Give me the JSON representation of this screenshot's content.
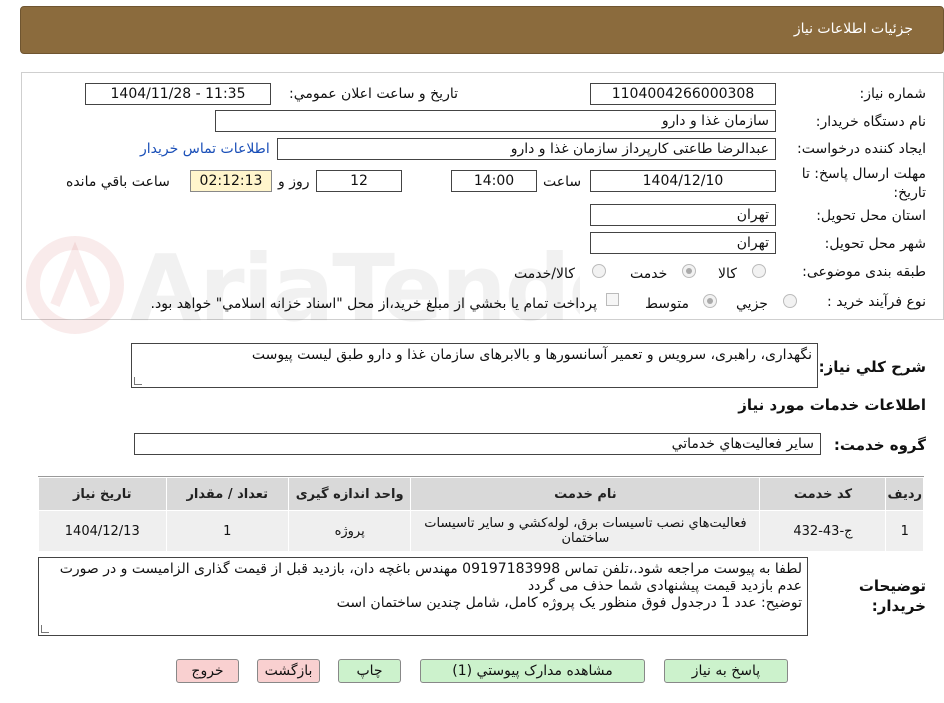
{
  "header": {
    "title": "جزئيات اطلاعات نياز"
  },
  "fields": {
    "need_number_label": "شماره نياز:",
    "need_number": "1104004266000308",
    "announce_label": "تاريخ و ساعت اعلان عمومي:",
    "announce_value": "1404/11/28 - 11:35",
    "buyer_org_label": "نام دستگاه خريدار:",
    "buyer_org": "سازمان غذا و دارو",
    "creator_label": "ايجاد کننده درخواست:",
    "creator": "عبدالرضا طاعتی کارپرداز سازمان غذا و دارو",
    "contact_link": "اطلاعات تماس خريدار",
    "deadline_label": "مهلت ارسال پاسخ: تا تاريخ:",
    "deadline_date": "1404/12/10",
    "time_label": "ساعت",
    "deadline_time": "14:00",
    "days_value": "12",
    "days_label": "روز و",
    "remaining_time": "02:12:13",
    "remaining_label": "ساعت باقي مانده",
    "province_label": "استان محل تحويل:",
    "province": "تهران",
    "city_label": "شهر محل تحويل:",
    "city": "تهران",
    "category_label": "طبقه بندی موضوعی:",
    "category_options": [
      "کالا",
      "خدمت",
      "کالا/خدمت"
    ],
    "process_label": "نوع فرآيند خريد :",
    "process_options": [
      "جزيي",
      "متوسط"
    ],
    "payment_note": "پرداخت تمام يا بخشي از مبلغ خريد،از محل \"اسناد خزانه اسلامي\" خواهد بود."
  },
  "description": {
    "label": "شرح کلي نياز:",
    "text": "نگهداری، راهبری، سرویس و تعمیر آسانسورها و بالابرهای سازمان غذا و دارو طبق لیست پیوست"
  },
  "services": {
    "section_title": "اطلاعات خدمات مورد نياز",
    "group_label": "گروه خدمت:",
    "group_value": "ساير فعاليت‌هاي خدماتي",
    "columns": [
      "رديف",
      "کد خدمت",
      "نام خدمت",
      "واحد اندازه گيری",
      "تعداد / مقدار",
      "تاريخ نياز"
    ],
    "rows": [
      [
        "1",
        "ج-43-432",
        "فعاليت‌هاي نصب تاسيسات برق، لوله‌کشي و ساير تاسيسات ساختمان",
        "پروژه",
        "1",
        "1404/12/13"
      ]
    ]
  },
  "buyer_notes": {
    "label": "توضيحات خريدار:",
    "lines": [
      "لطفا به پیوست مراجعه شود.،تلفن تماس 09197183998 مهندس باغچه دان، بازدید قبل از قیمت گذاری الزامیست و در صورت عدم بازدید قیمت پیشنهادی شما حذف می گردد",
      "توضیح: عدد 1 درجدول فوق منظور یک پروژه کامل، شامل چندین ساختمان است"
    ]
  },
  "buttons": {
    "reply": "پاسخ به نياز",
    "attachments": "مشاهده مدارک پيوستي (1)",
    "print": "چاپ",
    "back": "بازگشت",
    "exit": "خروج"
  },
  "watermark": "AriaTender.neT",
  "colors": {
    "header": "#8b6b3d",
    "green_button": "#ccf2cc",
    "pink_button": "#f9d0d0",
    "timer_bg": "#fff5cc",
    "link": "#1a4fb8"
  }
}
